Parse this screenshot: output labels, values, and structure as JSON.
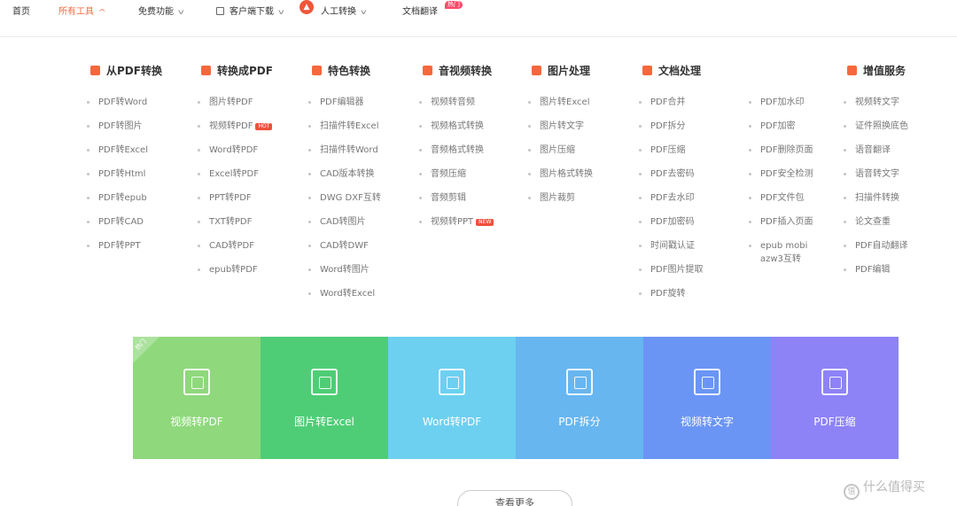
{
  "nav": {
    "home": "首页",
    "all_tools": "所有工具",
    "free_features": "免费功能",
    "client_download": "客户端下载",
    "manual_convert": "人工转换",
    "doc_translate": "文档翻译",
    "translate_badge": "热门"
  },
  "menu": {
    "columns": [
      {
        "title": "从PDF转换",
        "icon_color": "#f5683d",
        "items": [
          "PDF转Word",
          "PDF转图片",
          "PDF转Excel",
          "PDF转Html",
          "PDF转epub",
          "PDF转CAD",
          "PDF转PPT"
        ]
      },
      {
        "title": "转换成PDF",
        "icon_color": "#f5683d",
        "items": [
          "图片转PDF",
          "视频转PDF",
          "Word转PDF",
          "Excel转PDF",
          "PPT转PDF",
          "TXT转PDF",
          "CAD转PDF",
          "epub转PDF"
        ],
        "hot_badge": "HOT"
      },
      {
        "title": "特色转换",
        "icon_color": "#f5683d",
        "items": [
          "PDF编辑器",
          "扫描件转Excel",
          "扫描件转Word",
          "CAD版本转换",
          "DWG DXF互转",
          "CAD转图片",
          "CAD转DWF",
          "Word转图片",
          "Word转Excel"
        ]
      },
      {
        "title": "音视频转换",
        "icon_color": "#f5683d",
        "items": [
          "视频转音频",
          "视频格式转换",
          "音频格式转换",
          "音频压缩",
          "音频剪辑",
          "视频转PPT"
        ],
        "new_badge": "NEW"
      },
      {
        "title": "图片处理",
        "icon_color": "#f5683d",
        "items": [
          "图片转Excel",
          "图片转文字",
          "图片压缩",
          "图片格式转换",
          "图片裁剪"
        ]
      },
      {
        "title": "文档处理",
        "icon_color": "#f5683d",
        "items": [
          "PDF合并",
          "PDF拆分",
          "PDF压缩",
          "PDF去密码",
          "PDF去水印",
          "PDF加密码",
          "时间戳认证",
          "PDF图片提取",
          "PDF旋转"
        ]
      },
      {
        "title": "",
        "icon_color": "",
        "items": [
          "PDF加水印",
          "PDF加密",
          "PDF删除页面",
          "PDF安全检测",
          "PDF文件包",
          "PDF插入页面",
          "epub mobi azw3互转"
        ]
      },
      {
        "title": "增值服务",
        "icon_color": "#f5683d",
        "items": [
          "视频转文字",
          "证件照换底色",
          "语音翻译",
          "语音转文字",
          "扫描件转换",
          "论文查重",
          "PDF自动翻译",
          "PDF编辑"
        ]
      }
    ]
  },
  "tiles": {
    "corner_label": "热门",
    "items": [
      {
        "label": "视频转PDF",
        "color": "#8fd87c",
        "icon": "video-to-pdf-icon"
      },
      {
        "label": "图片转Excel",
        "color": "#4fcd76",
        "icon": "image-to-excel-icon"
      },
      {
        "label": "Word转PDF",
        "color": "#6dd0f0",
        "icon": "word-to-pdf-icon"
      },
      {
        "label": "PDF拆分",
        "color": "#67b6f0",
        "icon": "pdf-split-icon"
      },
      {
        "label": "视频转文字",
        "color": "#6b95f5",
        "icon": "video-to-text-icon"
      },
      {
        "label": "PDF压缩",
        "color": "#8d83f7",
        "icon": "pdf-compress-icon"
      }
    ]
  },
  "bottom": {
    "more_button": "查看更多",
    "watermark": "什么值得买",
    "watermark_icon": "值"
  }
}
